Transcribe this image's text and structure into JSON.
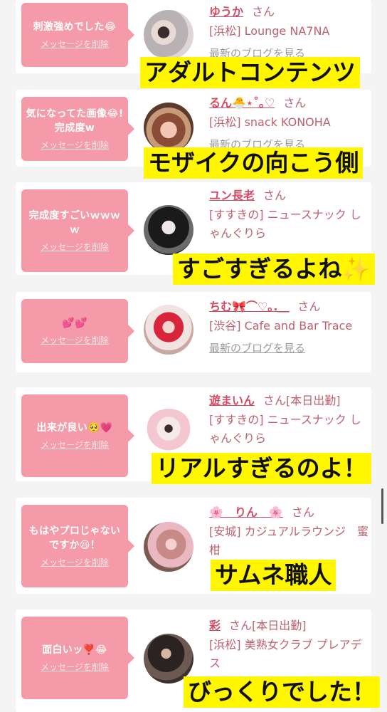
{
  "delete_label": "メッセージを削除",
  "blog_label": "最新のブログを見る",
  "honorific": "さん",
  "colors": {
    "bubble": "#f59aa8",
    "name": "#d64b64",
    "caption_bg": "#fff600"
  },
  "cards": [
    {
      "message": "刺激強めでした😂",
      "name": "ゆうか",
      "status": "",
      "shop": "[浜松] Lounge NA7NA",
      "caption": "アダルトコンテンツ"
    },
    {
      "message": "気になってた画像😂!完成度w",
      "name": "るん🐣⋆˚｡♡",
      "status": "",
      "shop": "[浜松] snack KONOHA",
      "caption": "モザイクの向こう側"
    },
    {
      "message": "完成度すごいｗｗｗｗ",
      "name": "ユン長老",
      "status": "",
      "shop": "[すすきの] ニュースナック しゃんぐりら",
      "caption": "すごすぎるよね✨"
    },
    {
      "message": "💕💕",
      "name": "ちむ🎀⌒♡｡.＿",
      "status": "",
      "shop": "[渋谷] Cafe and Bar Trace",
      "caption": ""
    },
    {
      "message": "出来が良い🥺💗",
      "name": "遊まいん",
      "status": "[本日出勤]",
      "shop": "[すすきの] ニュースナック しゃんぐりら",
      "caption": "リアルすぎるのよ！"
    },
    {
      "message": "もはやプロじゃないですか😆！",
      "name": "🌸　りん　🌸",
      "status": "",
      "shop": "[安城] カジュアルラウンジ　蜜柑",
      "caption": "サムネ職人"
    },
    {
      "message": "面白いッ❣️😂",
      "name": "彩",
      "status": "[本日出勤]",
      "shop": "[浜松] 美熟女クラブ プレアデス",
      "caption": "びっくりでした！"
    }
  ]
}
